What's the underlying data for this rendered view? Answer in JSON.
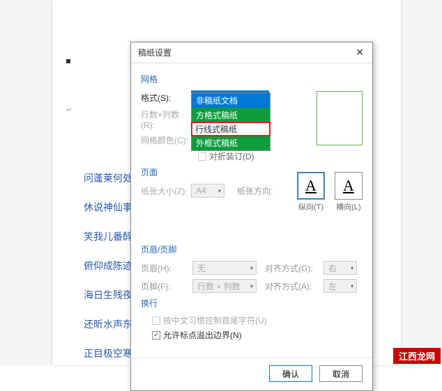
{
  "dialog": {
    "title": "稿纸设置",
    "sections": {
      "grid": "网格",
      "page": "页面",
      "headerfooter": "页眉/页脚",
      "linebreak": "换行"
    },
    "labels": {
      "format": "格式(S):",
      "rowscols": "行数×列数(R):",
      "gridcolor": "网格颜色(C):",
      "foldbind": "对折装订(D)",
      "papersize": "纸张大小(Z):",
      "paperorient": "纸张方向:",
      "header": "页眉(H):",
      "footer": "页脚(F):",
      "align1": "对齐方式(G):",
      "align2": "对齐方式(A):",
      "cjkfirst": "按中文习惯控制首尾字符(U)",
      "punctoverflow": "允许标点溢出边界(N)"
    },
    "values": {
      "format_selected": "非稿纸文档",
      "rowscols_value": "",
      "papersize": "A4",
      "header": "无",
      "footer": "行数 × 列数",
      "align_right": "右",
      "align_left": "左"
    },
    "format_options": [
      "非稿纸文档",
      "方格式稿纸",
      "行线式稿纸",
      "外框式稿纸"
    ],
    "orientation": {
      "portrait": "纵向(T)",
      "landscape": "横向(L)",
      "glyph": "A"
    },
    "buttons": {
      "ok": "确认",
      "cancel": "取消"
    }
  },
  "document": {
    "lines": [
      "问蓬莱何处，",
      "休说神仙事，",
      "笑我儿番醉酿",
      "俯仰成陈迹，",
      "海日生残夜，",
      "还昕水声东去",
      "正目极空寒，萧萧汉柏愁茂陵。↓"
    ]
  },
  "watermark": "江西龙网"
}
